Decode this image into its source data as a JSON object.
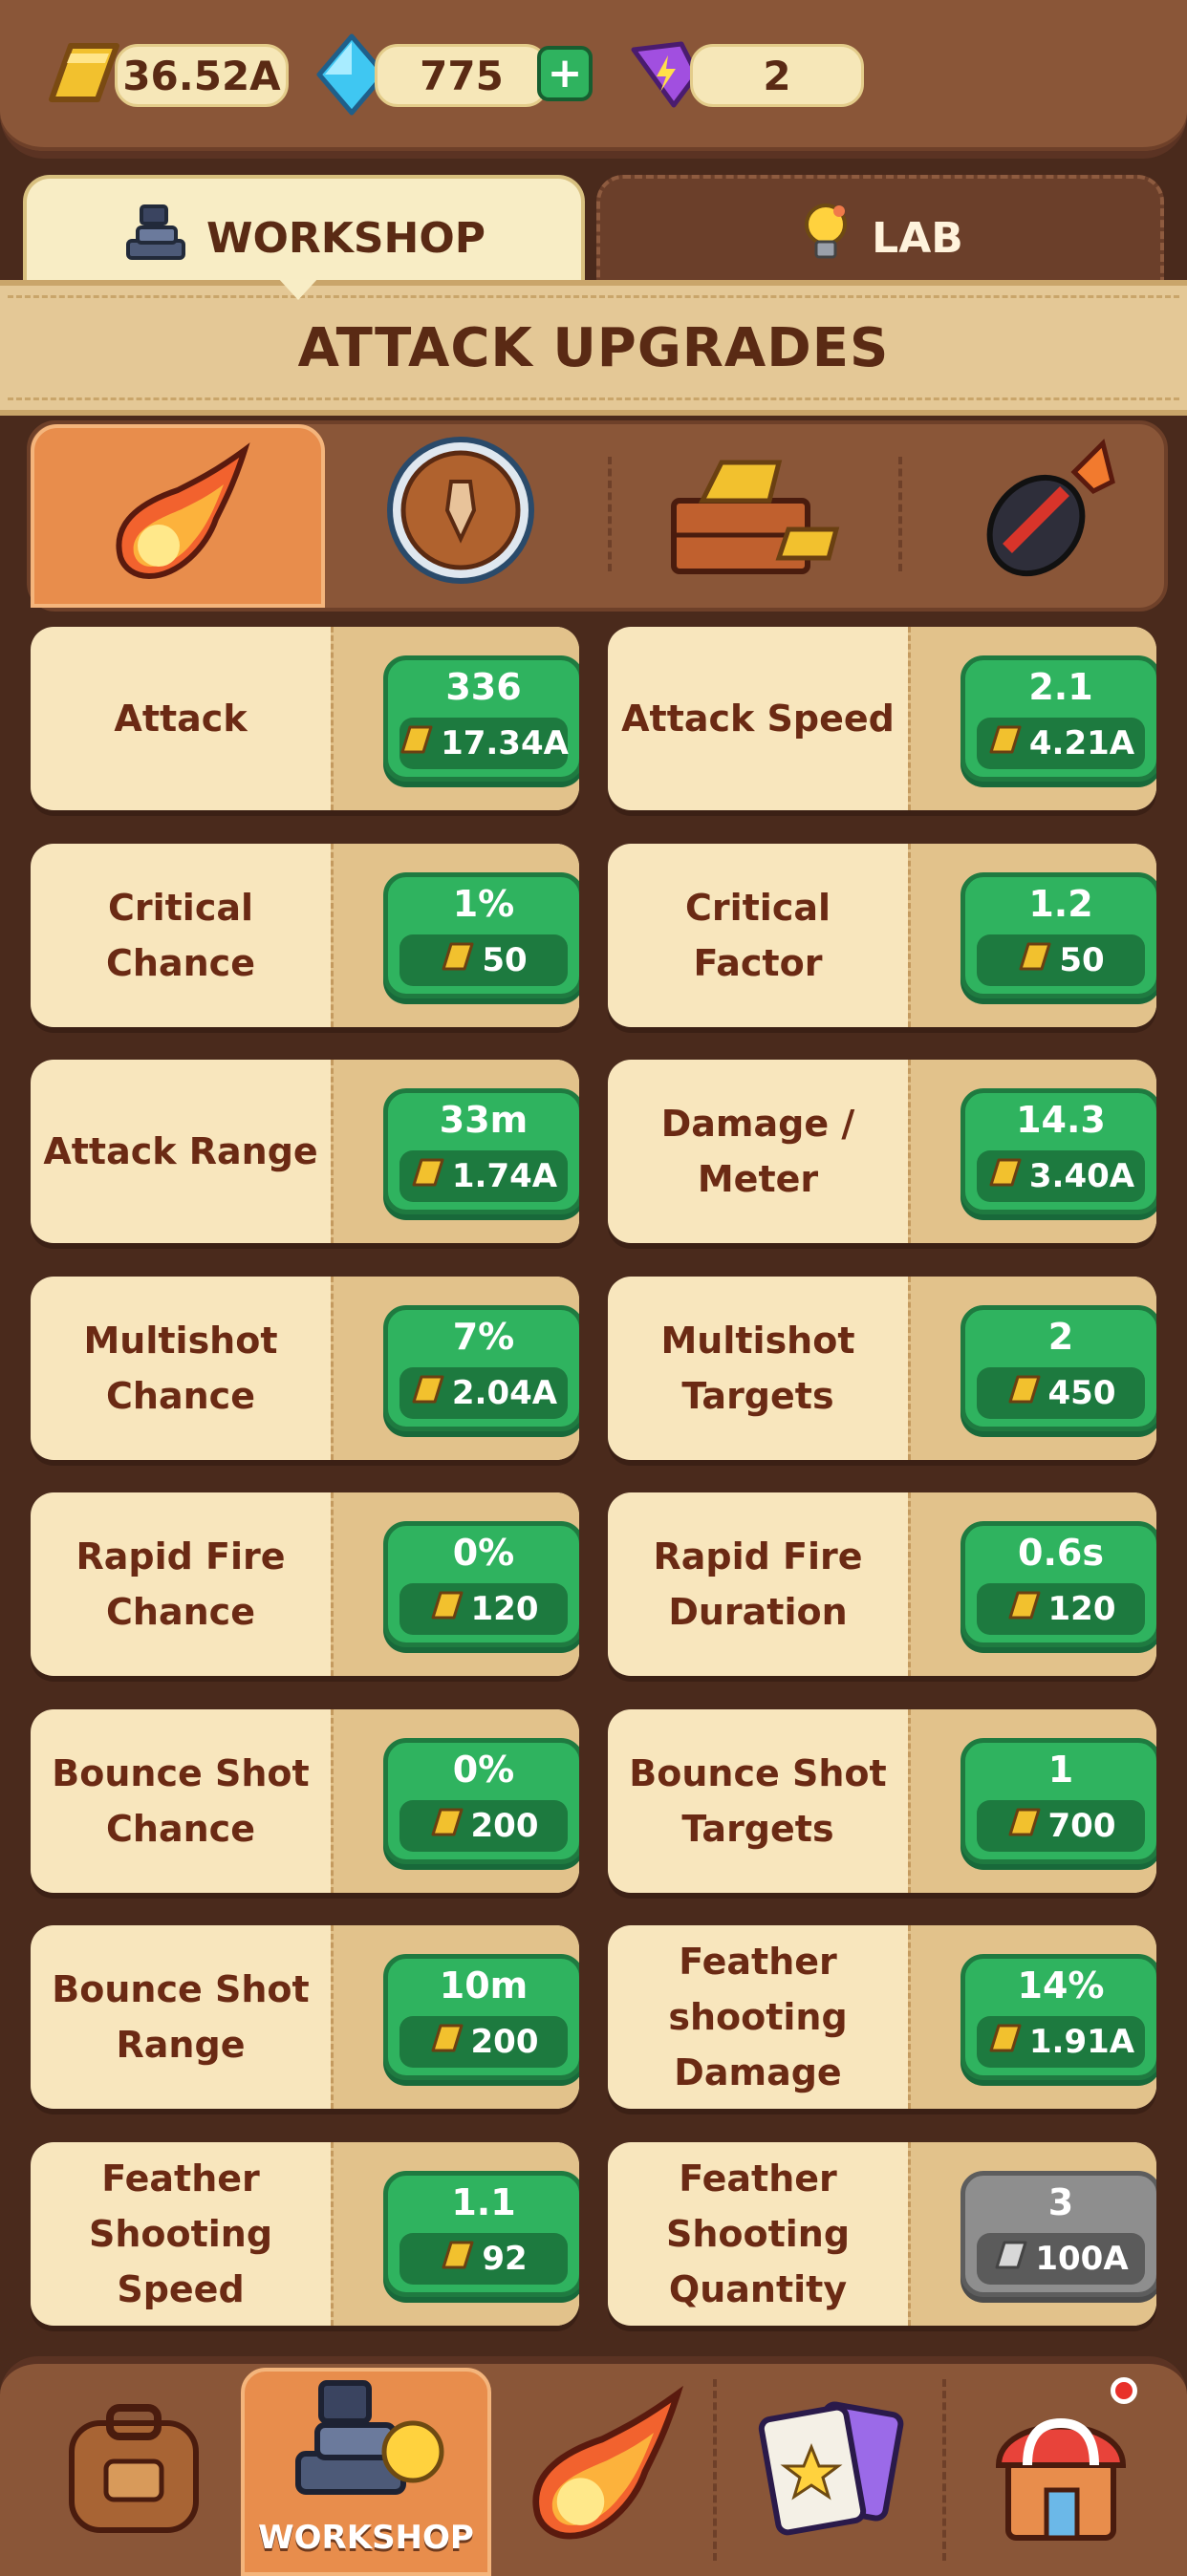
{
  "currency": {
    "gold": "36.52A",
    "gems": "775",
    "energy": "2"
  },
  "tabs": {
    "workshop": "WORKSHOP",
    "lab": "LAB"
  },
  "section_title": "ATTACK UPGRADES",
  "categories": [
    "fire-attack-icon",
    "shield-icon",
    "gold-crate-icon",
    "bomb-icon"
  ],
  "upgrades": [
    {
      "label": "Attack",
      "value": "336",
      "cost": "17.34A",
      "available": true
    },
    {
      "label": "Attack Speed",
      "value": "2.1",
      "cost": "4.21A",
      "available": true
    },
    {
      "label": "Critical Chance",
      "value": "1%",
      "cost": "50",
      "available": true
    },
    {
      "label": "Critical Factor",
      "value": "1.2",
      "cost": "50",
      "available": true
    },
    {
      "label": "Attack Range",
      "value": "33m",
      "cost": "1.74A",
      "available": true
    },
    {
      "label": "Damage / Meter",
      "value": "14.3",
      "cost": "3.40A",
      "available": true
    },
    {
      "label": "Multishot Chance",
      "value": "7%",
      "cost": "2.04A",
      "available": true
    },
    {
      "label": "Multishot Targets",
      "value": "2",
      "cost": "450",
      "available": true
    },
    {
      "label": "Rapid Fire Chance",
      "value": "0%",
      "cost": "120",
      "available": true
    },
    {
      "label": "Rapid Fire Duration",
      "value": "0.6s",
      "cost": "120",
      "available": true
    },
    {
      "label": "Bounce Shot Chance",
      "value": "0%",
      "cost": "200",
      "available": true
    },
    {
      "label": "Bounce Shot Targets",
      "value": "1",
      "cost": "700",
      "available": true
    },
    {
      "label": "Bounce Shot Range",
      "value": "10m",
      "cost": "200",
      "available": true
    },
    {
      "label": "Feather shooting Damage",
      "value": "14%",
      "cost": "1.91A",
      "available": true
    },
    {
      "label": "Feather Shooting Speed",
      "value": "1.1",
      "cost": "92",
      "available": true
    },
    {
      "label": "Feather Shooting Quantity",
      "value": "3",
      "cost": "100A",
      "available": false
    }
  ],
  "bottom_nav": {
    "active_label": "WORKSHOP"
  },
  "colors": {
    "button_green": "#2fb35f",
    "button_gray": "#8e8e8e",
    "card_label_text": "#6b2a14",
    "active_tab": "#e88d4c"
  }
}
